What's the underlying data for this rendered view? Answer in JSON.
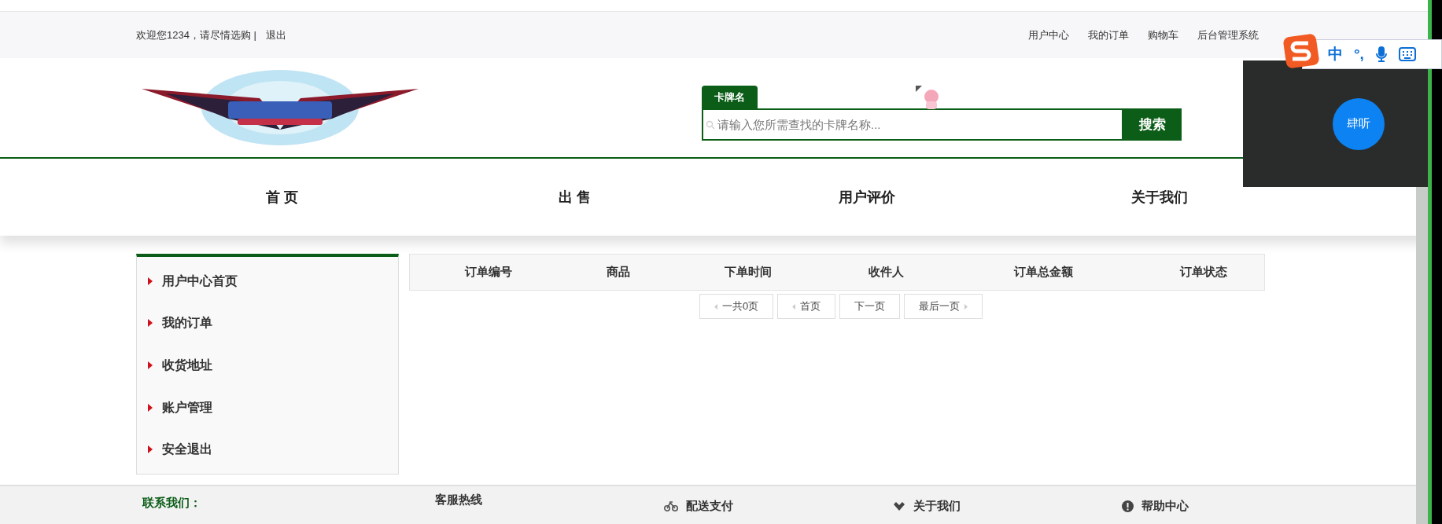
{
  "top_bar": {
    "greeting": "欢迎您1234，请尽情选购 |",
    "logout": "退出",
    "links": [
      "用户中心",
      "我的订单",
      "购物车",
      "后台管理系统"
    ]
  },
  "search": {
    "tab_label": "卡牌名",
    "placeholder": "请输入您所需查找的卡牌名称...",
    "button": "搜索"
  },
  "nav": [
    "首 页",
    "出 售",
    "用户评价",
    "关于我们"
  ],
  "sidebar": {
    "items": [
      "用户中心首页",
      "我的订单",
      "收货地址",
      "账户管理",
      "安全退出"
    ]
  },
  "orders_table": {
    "columns": [
      "订单编号",
      "商品",
      "下单时间",
      "收件人",
      "订单总金额",
      "订单状态"
    ]
  },
  "pagination": [
    {
      "label": "一共0页",
      "kind": "prev"
    },
    {
      "label": "首页",
      "kind": "prev"
    },
    {
      "label": "下一页",
      "kind": "plain"
    },
    {
      "label": "最后一页",
      "kind": "next"
    }
  ],
  "footer": {
    "contact_title": "联系我们：",
    "columns": [
      {
        "label": "客服热线",
        "kind": "plain"
      },
      {
        "label": "配送支付",
        "kind": "delivery"
      },
      {
        "label": "关于我们",
        "kind": "about"
      },
      {
        "label": "帮助中心",
        "kind": "help"
      }
    ]
  },
  "ime_toolbar": {
    "mode": "中",
    "punctuation": "°,"
  },
  "floating_panel": {
    "button": "肆听"
  }
}
